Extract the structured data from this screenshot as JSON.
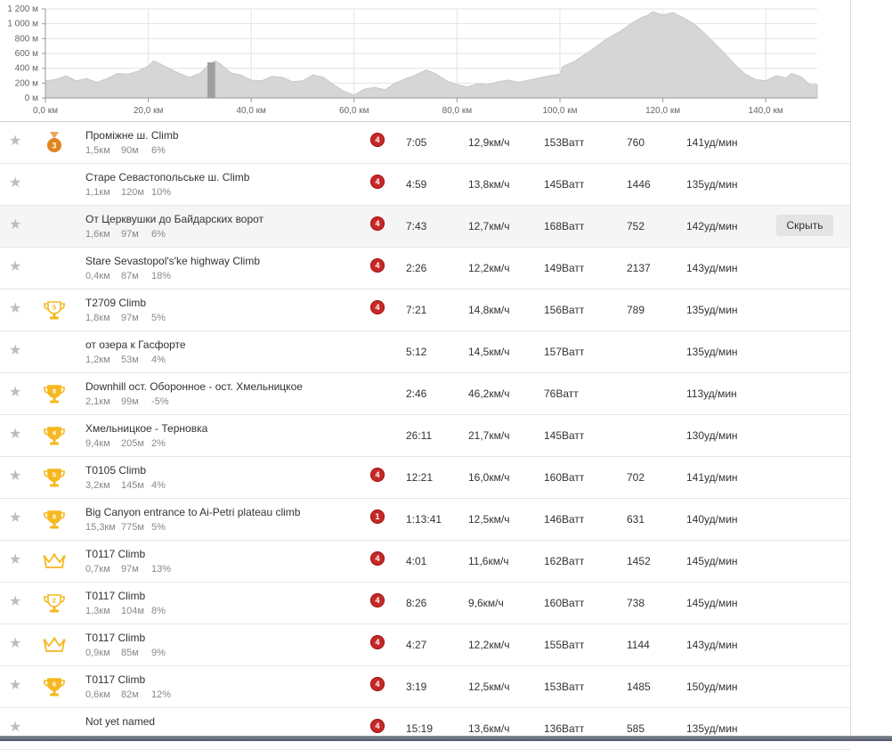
{
  "elevation_chart": {
    "type": "area",
    "x_unit": "км",
    "y_unit": "м",
    "x_ticks": [
      "0,0 км",
      "20,0 км",
      "40,0 км",
      "60,0 км",
      "80,0 км",
      "100,0 км",
      "120,0 км",
      "140,0 км"
    ],
    "y_ticks": [
      "0 м",
      "200 м",
      "400 м",
      "600 м",
      "800 м",
      "1 000 м",
      "1 200 м"
    ],
    "xlim": [
      0,
      150
    ],
    "ylim": [
      0,
      1200
    ],
    "fill_color": "#d6d6d6",
    "selection": {
      "from_km": 31.5,
      "to_km": 33.0
    },
    "profile": [
      [
        0,
        230
      ],
      [
        2,
        250
      ],
      [
        4,
        300
      ],
      [
        6,
        230
      ],
      [
        8,
        260
      ],
      [
        10,
        210
      ],
      [
        12,
        260
      ],
      [
        14,
        330
      ],
      [
        16,
        320
      ],
      [
        18,
        360
      ],
      [
        20,
        430
      ],
      [
        21,
        500
      ],
      [
        22,
        470
      ],
      [
        24,
        400
      ],
      [
        26,
        330
      ],
      [
        28,
        280
      ],
      [
        30,
        330
      ],
      [
        31.5,
        430
      ],
      [
        33,
        500
      ],
      [
        34,
        460
      ],
      [
        36,
        340
      ],
      [
        38,
        310
      ],
      [
        40,
        240
      ],
      [
        42,
        230
      ],
      [
        44,
        290
      ],
      [
        46,
        280
      ],
      [
        48,
        220
      ],
      [
        50,
        230
      ],
      [
        52,
        310
      ],
      [
        54,
        280
      ],
      [
        56,
        180
      ],
      [
        58,
        90
      ],
      [
        60,
        40
      ],
      [
        62,
        120
      ],
      [
        64,
        140
      ],
      [
        66,
        110
      ],
      [
        68,
        200
      ],
      [
        70,
        260
      ],
      [
        72,
        310
      ],
      [
        74,
        380
      ],
      [
        76,
        320
      ],
      [
        78,
        230
      ],
      [
        80,
        180
      ],
      [
        82,
        150
      ],
      [
        84,
        190
      ],
      [
        86,
        180
      ],
      [
        88,
        220
      ],
      [
        90,
        240
      ],
      [
        92,
        210
      ],
      [
        94,
        240
      ],
      [
        96,
        270
      ],
      [
        98,
        300
      ],
      [
        100,
        320
      ],
      [
        100.5,
        420
      ],
      [
        103,
        500
      ],
      [
        106,
        640
      ],
      [
        109,
        790
      ],
      [
        112,
        910
      ],
      [
        114,
        1010
      ],
      [
        116,
        1090
      ],
      [
        117,
        1110
      ],
      [
        118,
        1160
      ],
      [
        120,
        1120
      ],
      [
        122,
        1150
      ],
      [
        124,
        1080
      ],
      [
        126,
        1000
      ],
      [
        128,
        880
      ],
      [
        130,
        740
      ],
      [
        132,
        600
      ],
      [
        134,
        450
      ],
      [
        136,
        320
      ],
      [
        138,
        250
      ],
      [
        140,
        230
      ],
      [
        142,
        300
      ],
      [
        144,
        270
      ],
      [
        145,
        330
      ],
      [
        147,
        280
      ],
      [
        148.5,
        180
      ],
      [
        150,
        180
      ]
    ]
  },
  "segments": [
    {
      "name": "Проміжне ш. Climb",
      "dist": "1,5км",
      "elev": "90м",
      "grade": "6%",
      "medal": "bronze-3",
      "category": "4",
      "time": "7:05",
      "speed": "12,9км/ч",
      "power": "153Ватт",
      "vam": "760",
      "hr": "141уд/мин"
    },
    {
      "name": "Старе Севастопольське ш. Climb",
      "dist": "1,1км",
      "elev": "120м",
      "grade": "10%",
      "medal": "none",
      "category": "4",
      "time": "4:59",
      "speed": "13,8км/ч",
      "power": "145Ватт",
      "vam": "1446",
      "hr": "135уд/мин"
    },
    {
      "name": "От Церквушки до Байдарских ворот",
      "dist": "1,6км",
      "elev": "97м",
      "grade": "6%",
      "medal": "none",
      "category": "4",
      "time": "7:43",
      "speed": "12,7км/ч",
      "power": "168Ватт",
      "vam": "752",
      "hr": "142уд/мин",
      "highlight": true,
      "button": "Скрыть"
    },
    {
      "name": "Stare Sevastopol's'ke highway Climb",
      "dist": "0,4км",
      "elev": "87м",
      "grade": "18%",
      "medal": "none",
      "category": "4",
      "time": "2:26",
      "speed": "12,2км/ч",
      "power": "149Ватт",
      "vam": "2137",
      "hr": "143уд/мин"
    },
    {
      "name": "T2709 Climb",
      "dist": "1,8км",
      "elev": "97м",
      "grade": "5%",
      "medal": "trophy-outline-5",
      "category": "4",
      "time": "7:21",
      "speed": "14,8км/ч",
      "power": "156Ватт",
      "vam": "789",
      "hr": "135уд/мин"
    },
    {
      "name": "от озера к Гасфорте",
      "dist": "1,2км",
      "elev": "53м",
      "grade": "4%",
      "medal": "none",
      "category": "",
      "time": "5:12",
      "speed": "14,5км/ч",
      "power": "157Ватт",
      "vam": "",
      "hr": "135уд/мин"
    },
    {
      "name": "Downhill ост. Оборонное - ост. Хмельницкое",
      "dist": "2,1км",
      "elev": "99м",
      "grade": "-5%",
      "medal": "trophy-8",
      "category": "",
      "time": "2:46",
      "speed": "46,2км/ч",
      "power": "76Ватт",
      "vam": "",
      "hr": "113уд/мин"
    },
    {
      "name": "Хмельницкое - Терновка",
      "dist": "9,4км",
      "elev": "205м",
      "grade": "2%",
      "medal": "trophy-4",
      "category": "",
      "time": "26:11",
      "speed": "21,7км/ч",
      "power": "145Ватт",
      "vam": "",
      "hr": "130уд/мин"
    },
    {
      "name": "T0105 Climb",
      "dist": "3,2км",
      "elev": "145м",
      "grade": "4%",
      "medal": "trophy-5",
      "category": "4",
      "time": "12:21",
      "speed": "16,0км/ч",
      "power": "160Ватт",
      "vam": "702",
      "hr": "141уд/мин"
    },
    {
      "name": "Big Canyon entrance to Ai-Petri plateau climb",
      "dist": "15,3км",
      "elev": "775м",
      "grade": "5%",
      "medal": "trophy-8",
      "category": "1",
      "time": "1:13:41",
      "speed": "12,5км/ч",
      "power": "146Ватт",
      "vam": "631",
      "hr": "140уд/мин"
    },
    {
      "name": "T0117 Climb",
      "dist": "0,7км",
      "elev": "97м",
      "grade": "13%",
      "medal": "crown",
      "category": "4",
      "time": "4:01",
      "speed": "11,6км/ч",
      "power": "162Ватт",
      "vam": "1452",
      "hr": "145уд/мин"
    },
    {
      "name": "T0117 Climb",
      "dist": "1,3км",
      "elev": "104м",
      "grade": "8%",
      "medal": "trophy-outline-2",
      "category": "4",
      "time": "8:26",
      "speed": "9,6км/ч",
      "power": "160Ватт",
      "vam": "738",
      "hr": "145уд/мин"
    },
    {
      "name": "T0117 Climb",
      "dist": "0,9км",
      "elev": "85м",
      "grade": "9%",
      "medal": "crown",
      "category": "4",
      "time": "4:27",
      "speed": "12,2км/ч",
      "power": "155Ватт",
      "vam": "1144",
      "hr": "143уд/мин"
    },
    {
      "name": "T0117 Climb",
      "dist": "0,6км",
      "elev": "82м",
      "grade": "12%",
      "medal": "trophy-6",
      "category": "4",
      "time": "3:19",
      "speed": "12,5км/ч",
      "power": "153Ватт",
      "vam": "1485",
      "hr": "150уд/мин"
    },
    {
      "name": "Not yet named",
      "dist": "",
      "elev": "",
      "grade": "",
      "medal": "none",
      "category": "4",
      "time": "15:19",
      "speed": "13,6км/ч",
      "power": "136Ватт",
      "vam": "585",
      "hr": "135уд/мин"
    }
  ],
  "icons": {
    "star": "star-icon",
    "category": "category-badge"
  },
  "colors": {
    "gold": "#f5b820",
    "bronze": "#e0841b",
    "category_red": "#c62828",
    "star_grey": "#bdbdbd"
  }
}
